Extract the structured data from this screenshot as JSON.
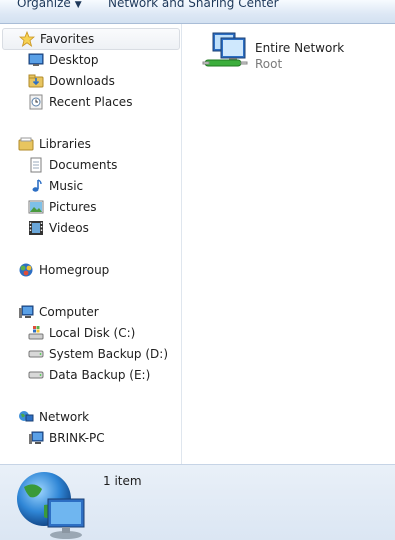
{
  "toolbar": {
    "organize_label": "Organize",
    "network_sharing_label": "Network and Sharing Center"
  },
  "nav": {
    "favorites": {
      "label": "Favorites",
      "items": [
        {
          "label": "Desktop"
        },
        {
          "label": "Downloads"
        },
        {
          "label": "Recent Places"
        }
      ]
    },
    "libraries": {
      "label": "Libraries",
      "items": [
        {
          "label": "Documents"
        },
        {
          "label": "Music"
        },
        {
          "label": "Pictures"
        },
        {
          "label": "Videos"
        }
      ]
    },
    "homegroup": {
      "label": "Homegroup"
    },
    "computer": {
      "label": "Computer",
      "items": [
        {
          "label": "Local Disk (C:)"
        },
        {
          "label": "System Backup (D:)"
        },
        {
          "label": "Data Backup (E:)"
        }
      ]
    },
    "network": {
      "label": "Network",
      "items": [
        {
          "label": "BRINK-PC"
        }
      ]
    }
  },
  "content": {
    "items": [
      {
        "name": "Entire Network",
        "type": "Root",
        "icon": "entire-network-icon"
      }
    ]
  },
  "details": {
    "count": "1 item"
  }
}
